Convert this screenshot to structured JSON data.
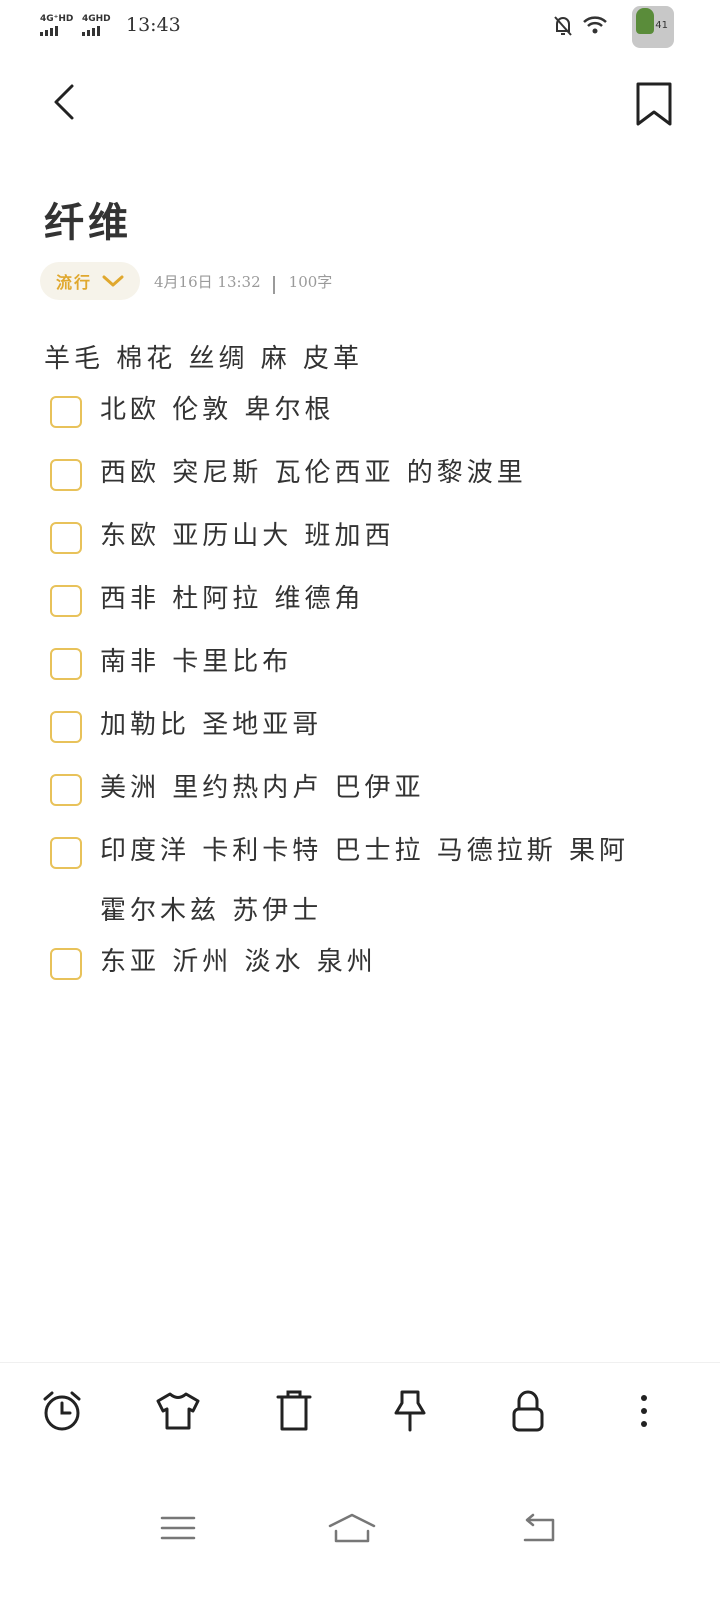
{
  "status_bar": {
    "signal1_label": "4G⁺HD",
    "signal2_label": "4GHD",
    "time": "13:43",
    "avatar_badge": "41"
  },
  "note": {
    "title": "纤维",
    "category": "流行",
    "date": "4月16日 13:32",
    "word_count": "100字",
    "intro_line": "羊毛 棉花 丝绸 麻 皮革",
    "checklist": [
      {
        "text": "北欧 伦敦 卑尔根",
        "checked": false
      },
      {
        "text": "西欧 突尼斯 瓦伦西亚 的黎波里",
        "checked": false
      },
      {
        "text": "东欧 亚历山大 班加西",
        "checked": false
      },
      {
        "text": "西非 杜阿拉 维德角",
        "checked": false
      },
      {
        "text": "南非 卡里比布",
        "checked": false
      },
      {
        "text": "加勒比 圣地亚哥",
        "checked": false
      },
      {
        "text": "美洲 里约热内卢 巴伊亚",
        "checked": false
      },
      {
        "text": "印度洋 卡利卡特 巴士拉 马德拉斯 果阿 霍尔木兹 苏伊士",
        "checked": false
      },
      {
        "text": "东亚 沂州 淡水 泉州",
        "checked": false
      }
    ]
  },
  "colors": {
    "accent": "#e0a82e",
    "checkbox_border": "#e8c25a",
    "pill_bg": "#f6f3ea",
    "meta_text": "#9a9a9a"
  },
  "toolbar_icons": [
    "alarm-icon",
    "shirt-icon",
    "trash-icon",
    "pin-icon",
    "lock-icon",
    "more-icon"
  ],
  "nav_icons": [
    "menu-icon",
    "home-icon",
    "back-icon"
  ]
}
